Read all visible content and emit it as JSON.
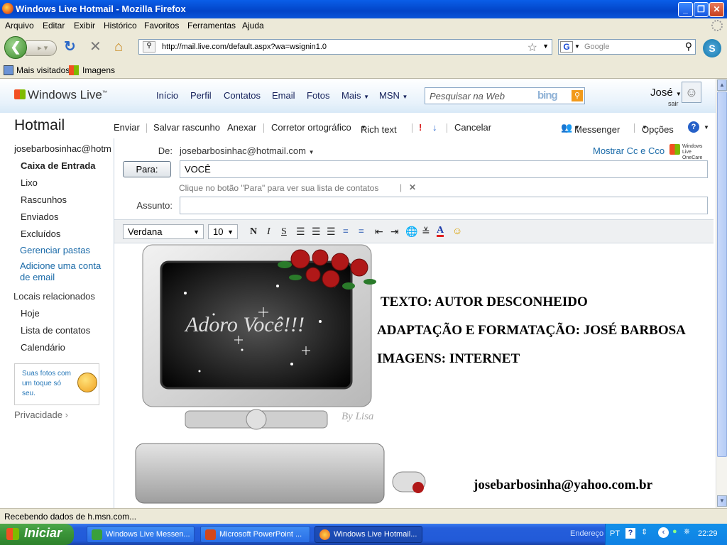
{
  "window": {
    "title": "Windows Live Hotmail - Mozilla Firefox"
  },
  "menu": [
    "Arquivo",
    "Editar",
    "Exibir",
    "Histórico",
    "Favoritos",
    "Ferramentas",
    "Ajuda"
  ],
  "nav": {
    "url": "http://mail.live.com/default.aspx?wa=wsignin1.0",
    "search_placeholder": "Google"
  },
  "bookmarks": [
    "Mais visitados",
    "Imagens"
  ],
  "header": {
    "brand": "Windows Live",
    "brand_tm": "™",
    "links": [
      "Início",
      "Perfil",
      "Contatos",
      "Email",
      "Fotos",
      "Mais",
      "MSN"
    ],
    "search_placeholder": "Pesquisar na Web",
    "bing": "bing",
    "user_name": "José",
    "signout": "sair"
  },
  "app_title": "Hotmail",
  "toolbar": {
    "send": "Enviar",
    "save_draft": "Salvar rascunho",
    "attach": "Anexar",
    "spellcheck": "Corretor ortográfico",
    "rich_text": "Rich text",
    "cancel": "Cancelar",
    "messenger": "Messenger",
    "options": "Opções"
  },
  "sidebar": {
    "account": "josebarbosinhac@hotm...",
    "folders": [
      "Caixa de Entrada",
      "Lixo",
      "Rascunhos",
      "Enviados",
      "Excluídos"
    ],
    "manage_folders": "Gerenciar pastas",
    "add_account": "Adicione uma conta de email",
    "related_title": "Locais relacionados",
    "related": [
      "Hoje",
      "Lista de contatos",
      "Calendário"
    ],
    "promo": "Suas fotos com um toque só seu.",
    "privacy": "Privacidade"
  },
  "compose": {
    "from_label": "De:",
    "from_value": "josebarbosinhac@hotmail.com",
    "show_cc": "Mostrar Cc e Cco",
    "onecare": "Windows Live OneCare",
    "to_button": "Para:",
    "to_value": "VOCÊ",
    "hint": "Clique no botão \"Para\" para ver sua lista de contatos",
    "subject_label": "Assunto:",
    "subject_value": "",
    "font": "Verdana",
    "size": "10"
  },
  "message": {
    "image_caption": "Adoro Você!!!",
    "image_signature": "By Lisa",
    "line1": "TEXTO: AUTOR DESCONHEIDO",
    "line2": "ADAPTAÇÃO E FORMATAÇÃO: JOSÉ BARBOSA",
    "line3": "IMAGENS: INTERNET",
    "email": "josebarbosinha@yahoo.com.br"
  },
  "status": "Recebendo dados de h.msn.com...",
  "taskbar": {
    "start": "Iniciar",
    "tasks": [
      "Windows Live Messen...",
      "Microsoft PowerPoint ...",
      "Windows Live Hotmail..."
    ],
    "address": "Endereço",
    "lang": "PT",
    "clock": "22:29"
  }
}
